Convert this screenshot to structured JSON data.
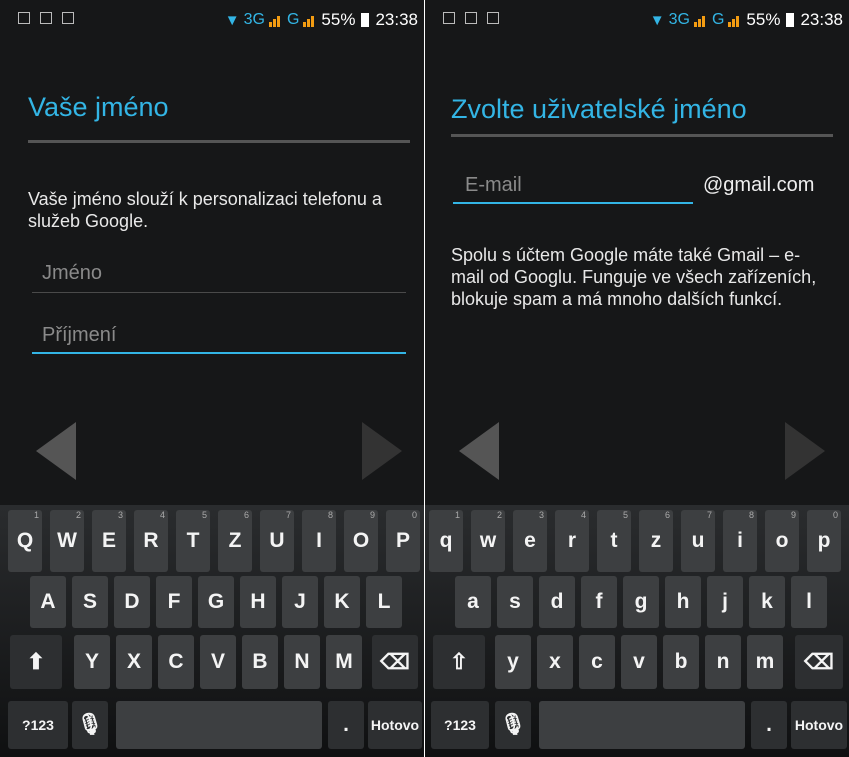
{
  "status_bar": {
    "network_3g": "3G",
    "network_g": "G",
    "battery": "55%",
    "time": "23:38"
  },
  "left": {
    "title": "Vaše jméno",
    "description": "Vaše jméno slouží k personalizaci telefonu a služeb Google.",
    "first_name_placeholder": "Jméno",
    "last_name_placeholder": "Příjmení"
  },
  "right": {
    "title": "Zvolte uživatelské jméno",
    "email_placeholder": "E-mail",
    "email_suffix": "@gmail.com",
    "description": "Spolu s účtem Google máte také Gmail – e-mail od Googlu. Funguje ve všech zařízeních, blokuje spam a má mnoho dalších funkcí."
  },
  "keyboard_left": {
    "row1": [
      "Q",
      "W",
      "E",
      "R",
      "T",
      "Z",
      "U",
      "I",
      "O",
      "P"
    ],
    "row2": [
      "A",
      "S",
      "D",
      "F",
      "G",
      "H",
      "J",
      "K",
      "L"
    ],
    "row3": [
      "Y",
      "X",
      "C",
      "V",
      "B",
      "N",
      "M"
    ],
    "hints": [
      "1",
      "2",
      "3",
      "4",
      "5",
      "6",
      "7",
      "8",
      "9",
      "0"
    ],
    "symbols_label": "?123",
    "period_label": ".",
    "done_label": "Hotovo"
  },
  "keyboard_right": {
    "row1": [
      "q",
      "w",
      "e",
      "r",
      "t",
      "z",
      "u",
      "i",
      "o",
      "p"
    ],
    "row2": [
      "a",
      "s",
      "d",
      "f",
      "g",
      "h",
      "j",
      "k",
      "l"
    ],
    "row3": [
      "y",
      "x",
      "c",
      "v",
      "b",
      "n",
      "m"
    ],
    "hints": [
      "1",
      "2",
      "3",
      "4",
      "5",
      "6",
      "7",
      "8",
      "9",
      "0"
    ],
    "symbols_label": "?123",
    "period_label": ".",
    "done_label": "Hotovo"
  },
  "icons": {
    "wifi": "wifi-icon",
    "battery": "battery-icon",
    "back": "back-arrow-icon",
    "next": "next-arrow-icon",
    "shift": "shift-icon",
    "delete": "delete-icon",
    "mic": "microphone-icon"
  },
  "colors": {
    "accent": "#33b5e5",
    "background": "#161718",
    "key": "#3d3f41",
    "signal_orange": "#f39c12"
  }
}
